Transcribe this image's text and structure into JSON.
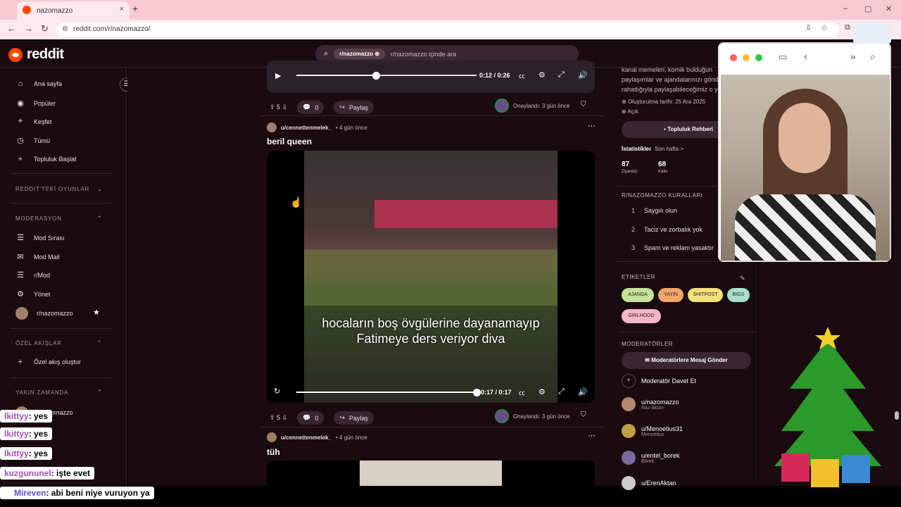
{
  "browser": {
    "tab_title": "nazomazzo",
    "tab_close": "×",
    "new_tab": "+",
    "url": "reddit.com/r/nazomazzo/",
    "window_controls": [
      "–",
      "▢",
      "✕"
    ]
  },
  "header": {
    "logo_text": "reddit",
    "search_chip": "r/nazomazzo",
    "search_placeholder": "r/nazomazzo içinde ara"
  },
  "sidebar": {
    "nav": [
      {
        "label": "Ana sayfa",
        "icon": "home-icon"
      },
      {
        "label": "Popüler",
        "icon": "popular-icon"
      },
      {
        "label": "Keşfet",
        "icon": "explore-icon"
      },
      {
        "label": "Tümü",
        "icon": "all-icon"
      },
      {
        "label": "Topluluk Başlat",
        "icon": "plus-icon"
      }
    ],
    "games_heading": "REDDIT'TEKİ OYUNLAR",
    "moderation_heading": "MODERASYON",
    "moderation": [
      {
        "label": "Mod Sırası",
        "icon": "queue-icon"
      },
      {
        "label": "Mod Mail",
        "icon": "mail-icon"
      },
      {
        "label": "r/Mod",
        "icon": "mod-icon"
      },
      {
        "label": "Yönet",
        "icon": "manage-icon"
      },
      {
        "label": "r/nazomazzo",
        "icon": "community-avatar"
      }
    ],
    "custom_feeds_heading": "ÖZEL AKIŞLAR",
    "create_feed": "Özel akış oluştur",
    "recent_heading": "YAKIN ZAMANDA",
    "recent": [
      "r/nazomazzo"
    ]
  },
  "posts": [
    {
      "time": "0:12 / 0:26",
      "progress": 0.44,
      "upvotes": "5",
      "comments": "0",
      "share": "Paylaş",
      "approved": "Onaylandı: 3 gün önce"
    },
    {
      "author": "u/cennettenmelek_",
      "age": "• 4 gün önce",
      "title": "beril queen",
      "caption_line1": "hocaların boş övgülerine dayanamayıp",
      "caption_line2": "Fatimeye ders veriyor diva",
      "time": "0:17 / 0:17",
      "progress": 1.0,
      "upvotes": "5",
      "comments": "0",
      "share": "Paylaş",
      "approved": "Onaylandı: 3 gün önce"
    },
    {
      "author": "u/cennettenmelek_",
      "age": "• 4 gün önce",
      "title": "tüh"
    }
  ],
  "right_panel": {
    "desc_line1": "kanal memeleri, komik bulduğun",
    "desc_line2": "paylaşımlar ve ajandalarınızı gönd",
    "desc_line3": "rahatlığıyla paylaşabileceğimiz o y",
    "created": "Oluşturulma tarihi: 25 Ara 2025",
    "visibility": "Açık",
    "guide_button": "Topluluk Rehberi",
    "stats_heading": "İstatistikler",
    "stats_period": "Son hafta >",
    "visitors_value": "87",
    "visitors_label": "Ziyaretçi",
    "contrib_value": "68",
    "contrib_label": "Katkı",
    "rules_heading": "R/NAZOMAZZO KURALLARI",
    "rules": [
      {
        "n": "1",
        "text": "Saygılı olun"
      },
      {
        "n": "2",
        "text": "Taciz ve zorbalık yok"
      },
      {
        "n": "3",
        "text": "Spam ve reklam yasaktır"
      }
    ],
    "tags_heading": "ETİKETLER",
    "tags": [
      {
        "label": "AJANDA",
        "color": "#c7e09a"
      },
      {
        "label": "YAYIN",
        "color": "#f2a46a"
      },
      {
        "label": "SHITPOST",
        "color": "#f2e07a"
      },
      {
        "label": "BIGS",
        "color": "#a8e0c8"
      },
      {
        "label": "GIRLHOOD",
        "color": "#f2b6c7"
      }
    ],
    "mods_heading": "MODERATÖRLER",
    "message_mods": "Moderatörlere Mesaj Gönder",
    "invite_mod": "Moderatör Davet Et",
    "mods": [
      {
        "name": "u/nazomazzo",
        "sub": "Naz Aktan",
        "color": "#b08870"
      },
      {
        "name": "u/Menoetius31",
        "sub": "Menoetius",
        "color": "#c0a040"
      },
      {
        "name": "u/entel_borek",
        "sub": "Börek",
        "color": "#7a6aa0"
      },
      {
        "name": "u/ErenAktan",
        "sub": "",
        "color": "#ccc"
      }
    ]
  },
  "chat": [
    {
      "user": "lkittyy",
      "msg": ": yes"
    },
    {
      "user": "lkittyy",
      "msg": ": yes"
    },
    {
      "user": "lkittyy",
      "msg": ": yes"
    },
    {
      "user": "kuzgununel",
      "msg": ": işte evet"
    },
    {
      "user": "Mireven",
      "msg": ": abi beni niye vuruyon ya"
    }
  ],
  "colors": {
    "accent": "#ff4500",
    "bg": "#1a0b10"
  }
}
